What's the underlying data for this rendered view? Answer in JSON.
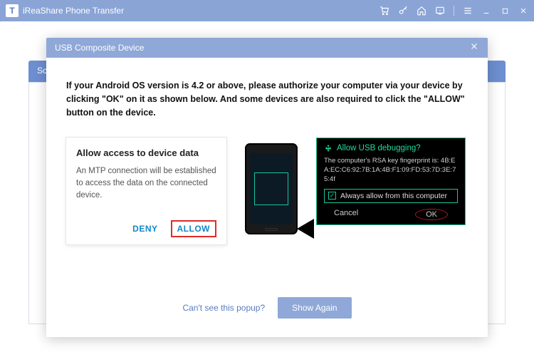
{
  "titlebar": {
    "logo_letter": "T",
    "app_title": "iReaShare Phone Transfer"
  },
  "hidden_tab": {
    "label": "Sc"
  },
  "dialog": {
    "title": "USB Composite Device",
    "instruction": "If your Android OS version is 4.2 or above, please authorize your computer via your device by clicking \"OK\" on it as shown below. And some devices are also required to click the \"ALLOW\" button on the device.",
    "allowbox": {
      "heading": "Allow access to device data",
      "body": "An MTP connection will be established to access the data on the connected device.",
      "deny": "DENY",
      "allow": "ALLOW"
    },
    "usbbox": {
      "title": "Allow USB debugging?",
      "fingerprint_label": "The computer's RSA key fingerprint is:",
      "fingerprint": "4B:EA:EC:C6:92:7B:1A:4B:F1:09:FD:53:7D:3E:75:4f",
      "always": "Always allow from this computer",
      "cancel": "Cancel",
      "ok": "OK"
    },
    "footer": {
      "cant": "Can't see this popup?",
      "show_again": "Show Again"
    }
  }
}
